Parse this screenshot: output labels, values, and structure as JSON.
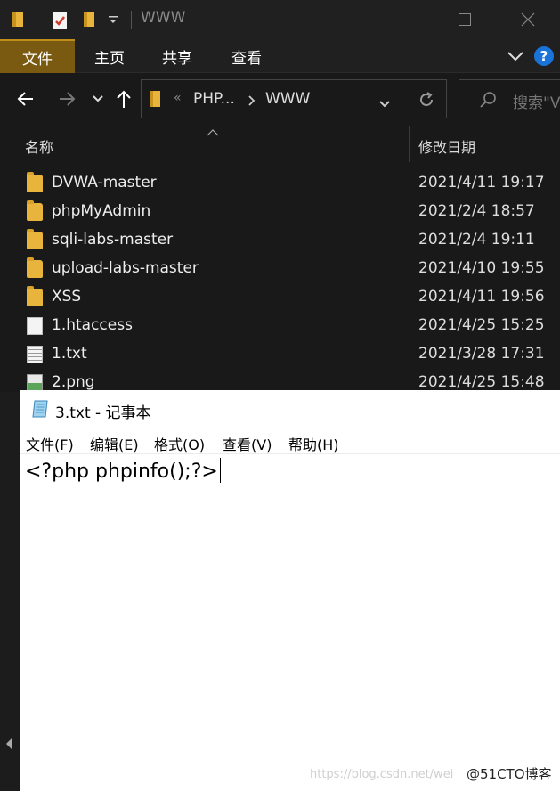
{
  "window": {
    "title": "WWW"
  },
  "ribbon": {
    "tabs": [
      "文件",
      "主页",
      "共享",
      "查看"
    ],
    "help": "?"
  },
  "address": {
    "crumb_prefix": "«",
    "segments": [
      "PHP...",
      "WWW"
    ]
  },
  "search": {
    "placeholder": "搜索\"V"
  },
  "columns": {
    "name": "名称",
    "date": "修改日期"
  },
  "files": [
    {
      "name": "DVWA-master",
      "date": "2021/4/11 19:17",
      "icon": "folder-icon"
    },
    {
      "name": "phpMyAdmin",
      "date": "2021/2/4 18:57",
      "icon": "folder-icon"
    },
    {
      "name": "sqli-labs-master",
      "date": "2021/2/4 19:11",
      "icon": "folder-icon"
    },
    {
      "name": "upload-labs-master",
      "date": "2021/4/10 19:55",
      "icon": "folder-icon"
    },
    {
      "name": "XSS",
      "date": "2021/4/11 19:56",
      "icon": "folder-icon"
    },
    {
      "name": "1.htaccess",
      "date": "2021/4/25 15:25",
      "icon": "file-icon"
    },
    {
      "name": "1.txt",
      "date": "2021/3/28 17:31",
      "icon": "text-file-icon"
    },
    {
      "name": "2.png",
      "date": "2021/4/25 15:48",
      "icon": "image-file-icon"
    }
  ],
  "notepad": {
    "title": "3.txt - 记事本",
    "menu": [
      "文件(F)",
      "编辑(E)",
      "格式(O)",
      "查看(V)",
      "帮助(H)"
    ],
    "content": "<?php phpinfo();?>"
  },
  "watermark": "https://blog.csdn.net/wei",
  "brand": "@51CTO博客",
  "colors": {
    "accent_tab": "#7a5a10",
    "folder": "#e8b43c",
    "help": "#1a73d8"
  }
}
